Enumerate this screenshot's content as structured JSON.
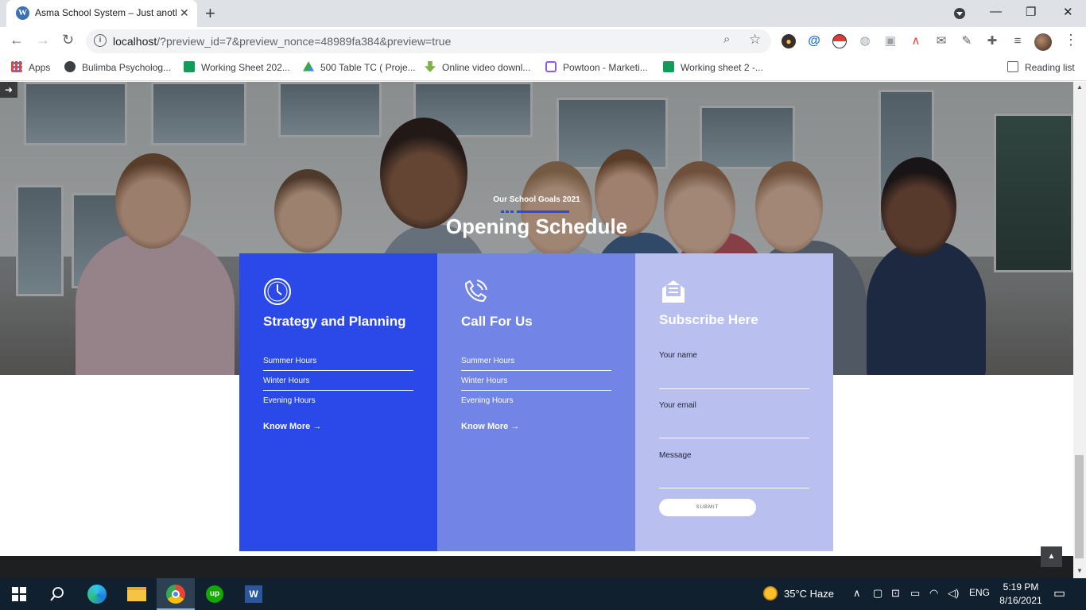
{
  "browser": {
    "tab": {
      "title": "Asma School System – Just anoth",
      "close": "✕"
    },
    "new_tab": "+",
    "window": {
      "minimize": "—",
      "restore": "❐",
      "close": "✕"
    },
    "url_host": "localhost",
    "url_rest": "/?preview_id=7&preview_nonce=48989fa384&preview=true",
    "bookmarks": [
      {
        "label": "Apps",
        "icon": "apps-grid-icon",
        "color": "#e8453c"
      },
      {
        "label": "Bulimba Psycholog...",
        "icon": "globe-icon",
        "color": "#3c4043"
      },
      {
        "label": "Working Sheet 202...",
        "icon": "sheets-icon",
        "color": "#0f9d58"
      },
      {
        "label": "500 Table TC ( Proje...",
        "icon": "drive-icon",
        "color": "#fbbc04"
      },
      {
        "label": "Online video downl...",
        "icon": "download-arrow-icon",
        "color": "#7cb342"
      },
      {
        "label": "Powtoon - Marketi...",
        "icon": "powtoon-icon",
        "color": "#8e5ce6"
      },
      {
        "label": "Working sheet 2 -...",
        "icon": "sheets-icon",
        "color": "#0f9d58"
      }
    ],
    "reading_list": "Reading list"
  },
  "page": {
    "subtitle": "Our School Goals 2021",
    "heading": "Opening Schedule",
    "accent_color": "#2b49e8",
    "cards": [
      {
        "title": "Strategy and Planning",
        "icon": "clock-icon",
        "rows": [
          "Summer Hours",
          "Winter Hours",
          "Evening Hours"
        ],
        "more": "Know More",
        "color": "#2b49e8"
      },
      {
        "title": "Call For Us",
        "icon": "phone-ringing-icon",
        "rows": [
          "Summer Hours",
          "Winter Hours",
          "Evening Hours"
        ],
        "more": "Know More",
        "color": "#7285e6"
      }
    ],
    "subscribe": {
      "title": "Subscribe Here",
      "icon": "envelope-icon",
      "name_label": "Your name",
      "email_label": "Your email",
      "message_label": "Message",
      "submit": "SUBMIT",
      "color": "#b9c0ef"
    }
  },
  "taskbar": {
    "weather": "35°C  Haze",
    "language": "ENG",
    "time": "5:19 PM",
    "date": "8/16/2021"
  }
}
